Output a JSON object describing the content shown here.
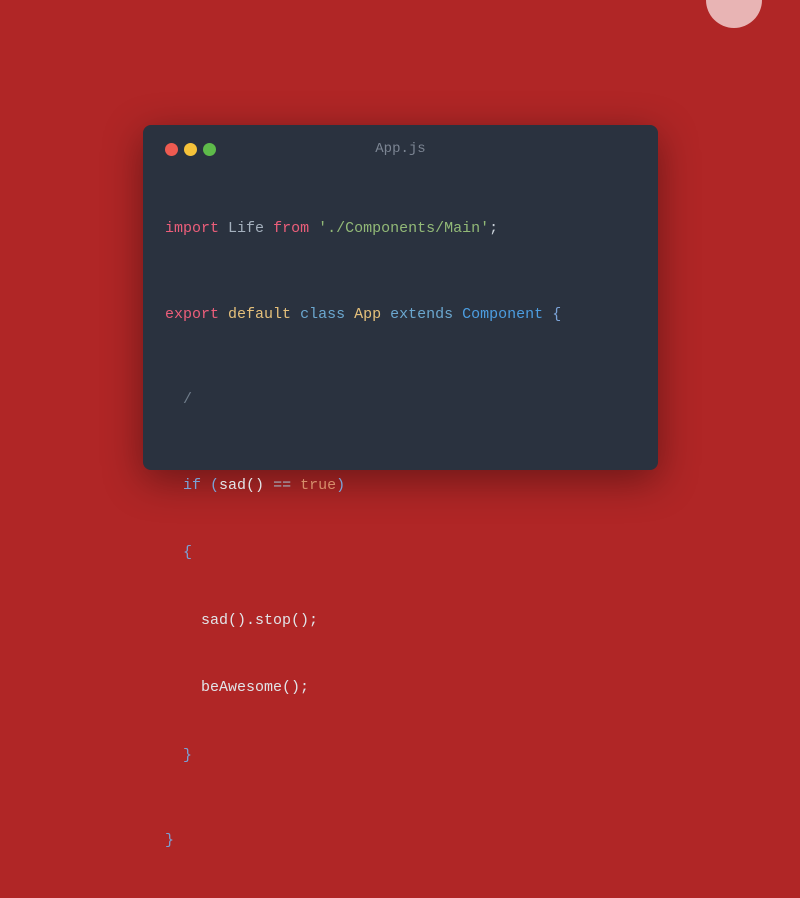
{
  "window": {
    "title": "App.js",
    "controls": {
      "close": "close",
      "minimize": "minimize",
      "maximize": "maximize"
    }
  },
  "code": {
    "line1": {
      "import": "import",
      "ident": "Life",
      "from": "from",
      "path": "'./Components/Main'",
      "semi": ";"
    },
    "line2": {
      "export": "export",
      "default": "default",
      "class": "class",
      "classname": "App",
      "extends": "extends",
      "component": "Component",
      "brace": "{"
    },
    "line3": {
      "slash": "/"
    },
    "line4": {
      "if": "if",
      "lparen": "(",
      "call": "sad()",
      "op": " == ",
      "true": "true",
      "rparen": ")"
    },
    "line5": {
      "brace": "{"
    },
    "line6": {
      "call": "sad().stop();"
    },
    "line7": {
      "call": "beAwesome();"
    },
    "line8": {
      "brace": "}"
    },
    "line9": {
      "brace": "}"
    }
  }
}
